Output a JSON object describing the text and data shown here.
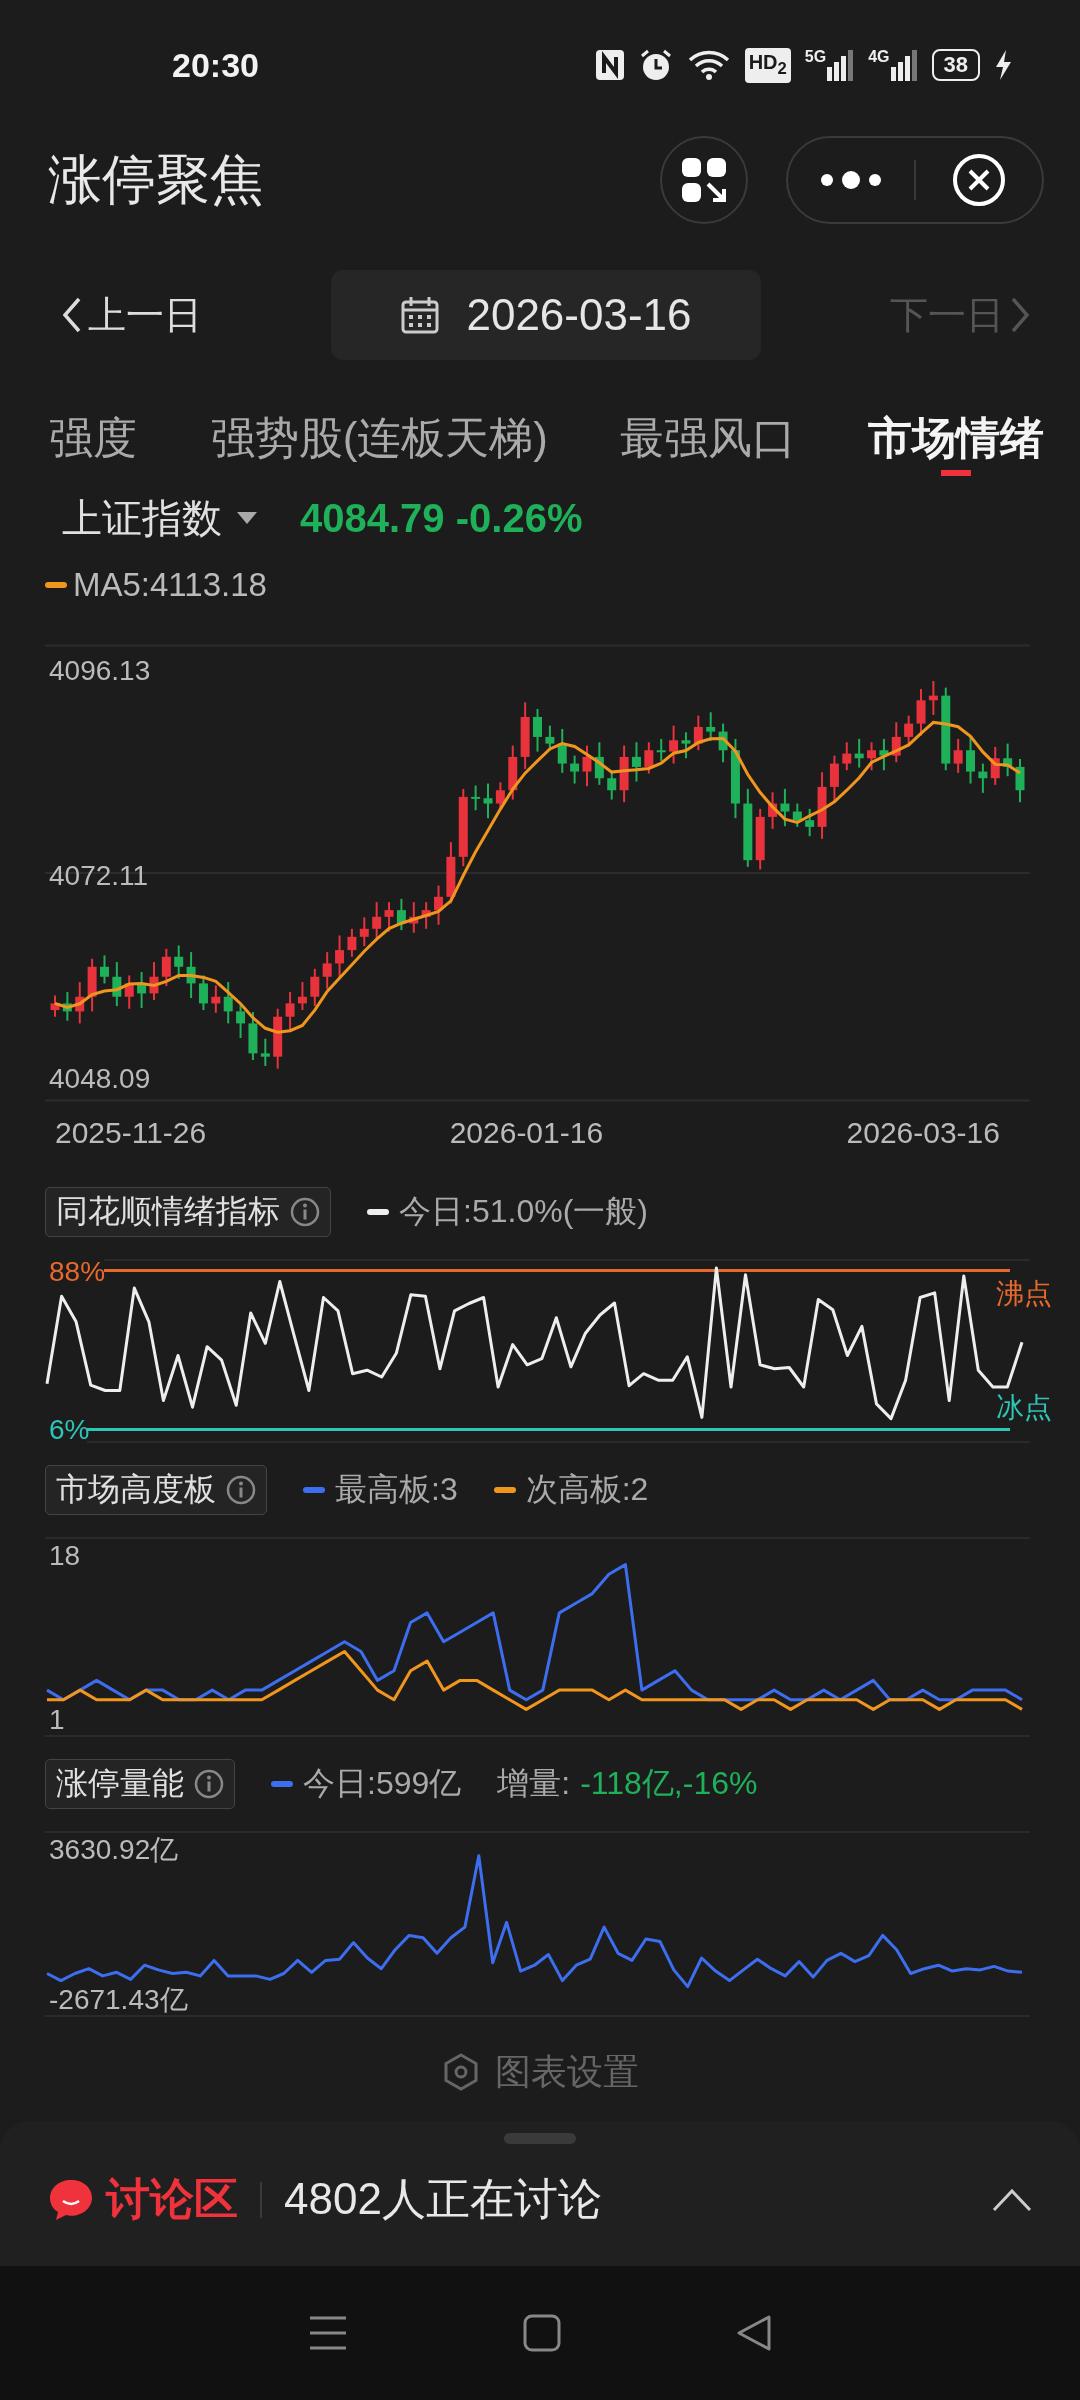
{
  "status_bar": {
    "time": "20:30",
    "hd": "HD$_{2}$",
    "networks": [
      {
        "label": "5G"
      },
      {
        "label": "4G"
      }
    ],
    "battery": "38",
    "charging": true
  },
  "header": {
    "title": "涨停聚焦"
  },
  "date_nav": {
    "prev": "上一日",
    "date": "2026-03-16",
    "next": "下一日",
    "next_disabled": true
  },
  "tabs": [
    {
      "label": "强度",
      "selected": false
    },
    {
      "label": "强势股(连板天梯)",
      "selected": false
    },
    {
      "label": "最强风口",
      "selected": false
    },
    {
      "label": "市场情绪",
      "selected": true
    }
  ],
  "index": {
    "name": "上证指数",
    "quote": "4084.79 -0.26%"
  },
  "kline": {
    "ma_legend": "MA5:4113.18",
    "y_labels": [
      "4096.13",
      "4072.11",
      "4048.09"
    ],
    "x_labels": [
      "2025-11-26",
      "2026-01-16",
      "2026-03-16"
    ]
  },
  "sentiment": {
    "title": "同花顺情绪指标",
    "chart_data": {
      "type": "line",
      "ylim": [
        -1,
        94
      ],
      "series": [
        {
          "name": "今日:51.0%(一般)",
          "color": "#eeeeee",
          "values": [
            29.6,
            74.8,
            61.6,
            28.9,
            26.1,
            26.1,
            79.0,
            61.6,
            20.9,
            44.2,
            17.5,
            48.7,
            41.8,
            18.5,
            66.1,
            50.5,
            82.4,
            53.9,
            26.1,
            74.1,
            67.2,
            34.8,
            36.6,
            33.1,
            45.3,
            75.5,
            74.8,
            37.3,
            67.2,
            71.0,
            74.1,
            27.9,
            49.8,
            39.4,
            42.5,
            63.7,
            38.3,
            55.7,
            65.1,
            71.3,
            28.6,
            34.8,
            31.4,
            31.4,
            43.5,
            12.2,
            89.4,
            27.9,
            85.9,
            39.4,
            37.3,
            38.0,
            27.9,
            73.1,
            67.8,
            44.2,
            59.2,
            19.2,
            11.6,
            31.4,
            74.1,
            76.5,
            20.9,
            85.2,
            36.6,
            27.9,
            27.9,
            51.0
          ]
        }
      ],
      "yticks": [
        {
          "value": 88,
          "label": "88%"
        },
        {
          "value": 6,
          "label": "6%"
        }
      ],
      "ref_lines": [
        {
          "axis": "y",
          "value": 88,
          "label": "沸点",
          "color": "#e8692e"
        },
        {
          "axis": "y",
          "value": 6,
          "label": "冰点",
          "color": "#2ec4b6"
        }
      ]
    }
  },
  "height_board": {
    "title": "市场高度板",
    "chart_data": {
      "type": "line",
      "ylim": [
        1,
        18
      ],
      "yticks": [
        1,
        18
      ],
      "series": [
        {
          "name": "最高板:3",
          "color": "#3d6ef0",
          "values": [
            4,
            3,
            4,
            5,
            4,
            3,
            4,
            4,
            3,
            3,
            4,
            3,
            4,
            4,
            5,
            6,
            7,
            8,
            9,
            8,
            5,
            6,
            11,
            12,
            9,
            10,
            11,
            12,
            4,
            3,
            4,
            12,
            13,
            14,
            16,
            17,
            4,
            5,
            6,
            4,
            3,
            3,
            3,
            3,
            4,
            3,
            3,
            4,
            3,
            4,
            5,
            3,
            3,
            4,
            3,
            3,
            4,
            4,
            4,
            3
          ]
        },
        {
          "name": "次高板:2",
          "color": "#f0961e",
          "values": [
            3,
            3,
            4,
            3,
            3,
            3,
            4,
            3,
            3,
            3,
            3,
            3,
            3,
            3,
            4,
            5,
            6,
            7,
            8,
            6,
            4,
            3,
            6,
            7,
            4,
            5,
            5,
            4,
            3,
            2,
            3,
            4,
            4,
            4,
            3,
            4,
            3,
            3,
            3,
            3,
            3,
            3,
            2,
            3,
            3,
            2,
            3,
            3,
            3,
            3,
            2,
            3,
            3,
            3,
            2,
            3,
            3,
            3,
            3,
            2
          ]
        }
      ]
    }
  },
  "volume": {
    "title": "涨停量能",
    "delta_label": "增量:",
    "delta_value": "-118亿,-16%",
    "chart_data": {
      "type": "line",
      "ylim": [
        -2671.43,
        3630.92
      ],
      "yticks": [
        {
          "value": 3630.92,
          "label": "3630.92亿"
        },
        {
          "value": -2671.43,
          "label": "-2671.43亿"
        }
      ],
      "series": [
        {
          "name": "今日:599亿",
          "color": "#3d6ef0",
          "values": [
            -1600,
            -1900,
            -1600,
            -1400,
            -1700,
            -1550,
            -1850,
            -1250,
            -1450,
            -1600,
            -1550,
            -1700,
            -1050,
            -1700,
            -1700,
            -1700,
            -1850,
            -1600,
            -1050,
            -1550,
            -1050,
            -1000,
            -300,
            -950,
            -1400,
            -600,
            0,
            -100,
            -750,
            -100,
            350,
            3350,
            -1150,
            550,
            -1500,
            -1250,
            -800,
            -1900,
            -1250,
            -1000,
            350,
            -750,
            -1050,
            -150,
            -250,
            -1450,
            -2150,
            -950,
            -1500,
            -1900,
            -1450,
            -1000,
            -1400,
            -1700,
            -1100,
            -1750,
            -1050,
            -750,
            -1100,
            -850,
            0,
            -600,
            -1600,
            -1400,
            -1250,
            -1500,
            -1400,
            -1450,
            -1300,
            -1500,
            -1550
          ]
        }
      ]
    }
  },
  "settings_label": "图表设置",
  "discussion": {
    "title": "讨论区",
    "count_text": "4802人正在讨论"
  }
}
